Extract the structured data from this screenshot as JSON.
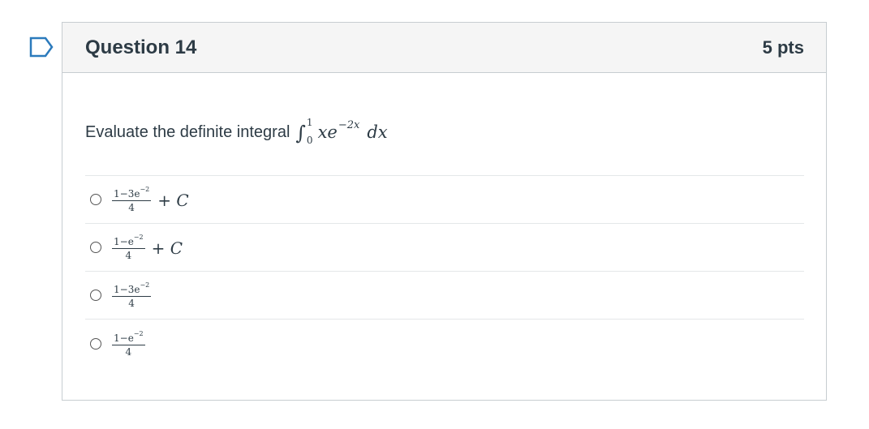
{
  "question": {
    "title": "Question 14",
    "points": "5 pts",
    "prompt": "Evaluate the definite integral",
    "integral": {
      "lower": "0",
      "upper": "1",
      "integrand": "xe",
      "exponent": "−2x",
      "differential": "dx"
    }
  },
  "answers": [
    {
      "numerator": "1−3e",
      "exp": "−2",
      "denominator": "4",
      "suffix": "+ C"
    },
    {
      "numerator": "1−e",
      "exp": "−2",
      "denominator": "4",
      "suffix": "+ C"
    },
    {
      "numerator": "1−3e",
      "exp": "−2",
      "denominator": "4",
      "suffix": ""
    },
    {
      "numerator": "1−e",
      "exp": "−2",
      "denominator": "4",
      "suffix": ""
    }
  ],
  "icons": {
    "flag": "bookmark-flag-icon",
    "radio": "radio-button"
  },
  "colors": {
    "text": "#2d3b45",
    "flag": "#2b7abc",
    "header_bg": "#f5f5f5",
    "border": "#c7cdd1"
  }
}
